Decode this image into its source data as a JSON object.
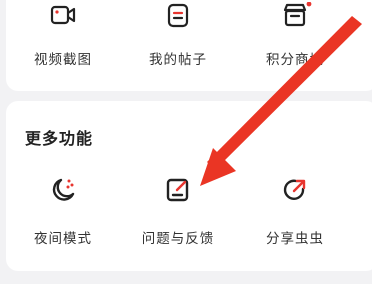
{
  "top_grid": {
    "items": [
      {
        "label": "视频截图",
        "icon": "video-icon"
      },
      {
        "label": "我的帖子",
        "icon": "document-icon"
      },
      {
        "label": "积分商城",
        "icon": "store-icon"
      }
    ]
  },
  "more_features": {
    "title": "更多功能",
    "items": [
      {
        "label": "夜间模式",
        "icon": "night-mode-icon"
      },
      {
        "label": "问题与反馈",
        "icon": "feedback-edit-icon"
      },
      {
        "label": "分享虫虫",
        "icon": "share-icon"
      }
    ]
  },
  "colors": {
    "accent": "#e8352f",
    "icon_stroke": "#222222",
    "background": "#f2f2f4",
    "card": "#ffffff"
  }
}
